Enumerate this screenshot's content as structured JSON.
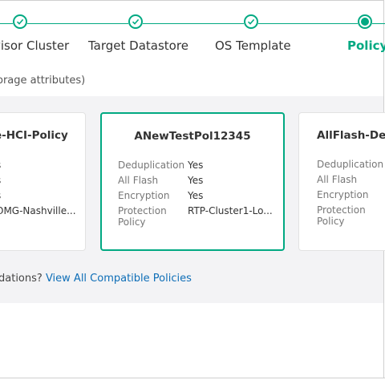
{
  "steps": [
    {
      "label": "visor Cluster",
      "state": "complete"
    },
    {
      "label": "Target Datastore",
      "state": "complete"
    },
    {
      "label": "OS Template",
      "state": "complete"
    },
    {
      "label": "Policy",
      "state": "active"
    }
  ],
  "subtitle": "orage attributes)",
  "cards": [
    {
      "title": "e-HCI-Policy",
      "values": [
        "s",
        "s",
        "s",
        "OMG-Nashville..."
      ]
    },
    {
      "title": "ANewTestPol12345",
      "selected": true,
      "rows": [
        {
          "key": "Deduplication",
          "value": "Yes"
        },
        {
          "key": "All Flash",
          "value": "Yes"
        },
        {
          "key": "Encryption",
          "value": "Yes"
        },
        {
          "key": "Protection Policy",
          "value": "RTP-Cluster1-Lo..."
        }
      ]
    },
    {
      "title": "AllFlash-Dedu",
      "rows": [
        {
          "key": "Deduplication",
          "value": ""
        },
        {
          "key": "All Flash",
          "value": ""
        },
        {
          "key": "Encryption",
          "value": ""
        },
        {
          "key": "Protection Policy",
          "value": ""
        }
      ]
    }
  ],
  "footer": {
    "text": "dations?",
    "link": "View All Compatible Policies"
  },
  "colors": {
    "accent": "#01a982",
    "link": "#0e6eb7",
    "panel": "#f3f3f5"
  },
  "icons": {
    "complete": "checkmark-icon",
    "active": "current-step-icon"
  }
}
